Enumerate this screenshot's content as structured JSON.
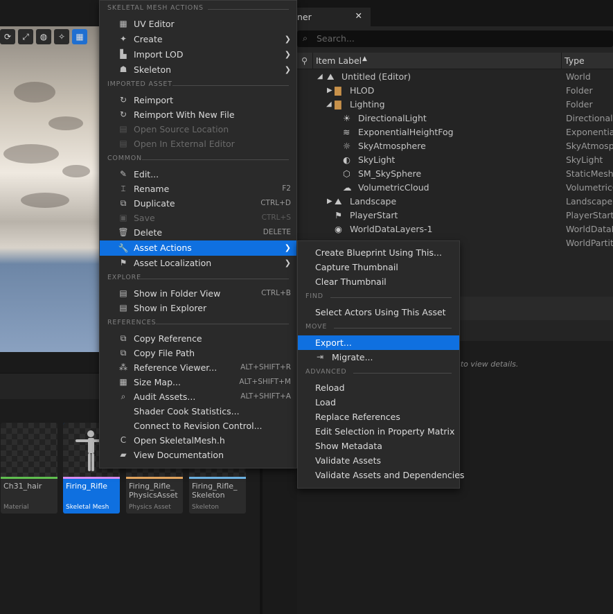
{
  "context_menu": {
    "sections": {
      "skeletal_mesh_actions": "SKELETAL MESH ACTIONS",
      "imported_asset": "IMPORTED ASSET",
      "common": "COMMON",
      "explore": "EXPLORE",
      "references": "REFERENCES"
    },
    "items": {
      "uv_editor": "UV Editor",
      "create": "Create",
      "import_lod": "Import LOD",
      "skeleton": "Skeleton",
      "reimport": "Reimport",
      "reimport_new": "Reimport With New File",
      "open_source": "Open Source Location",
      "open_external": "Open In External Editor",
      "edit": "Edit...",
      "rename": "Rename",
      "duplicate": "Duplicate",
      "save": "Save",
      "delete": "Delete",
      "asset_actions": "Asset Actions",
      "asset_localization": "Asset Localization",
      "show_folder": "Show in Folder View",
      "show_explorer": "Show in Explorer",
      "copy_reference": "Copy Reference",
      "copy_file_path": "Copy File Path",
      "reference_viewer": "Reference Viewer...",
      "size_map": "Size Map...",
      "audit_assets": "Audit Assets...",
      "shader_cook": "Shader Cook Statistics...",
      "connect_revision": "Connect to Revision Control...",
      "open_source_file": "Open SkeletalMesh.h",
      "view_docs": "View Documentation"
    },
    "shortcuts": {
      "rename": "F2",
      "duplicate": "CTRL+D",
      "save": "CTRL+S",
      "delete": "DELETE",
      "show_folder": "CTRL+B",
      "reference_viewer": "ALT+SHIFT+R",
      "size_map": "ALT+SHIFT+M",
      "audit_assets": "ALT+SHIFT+A"
    }
  },
  "submenu": {
    "sections": {
      "find": "FIND",
      "move": "MOVE",
      "advanced": "ADVANCED"
    },
    "items": {
      "create_blueprint": "Create Blueprint Using This...",
      "capture_thumbnail": "Capture Thumbnail",
      "clear_thumbnail": "Clear Thumbnail",
      "select_actors": "Select Actors Using This Asset",
      "export": "Export...",
      "migrate": "Migrate...",
      "reload": "Reload",
      "load": "Load",
      "replace_refs": "Replace References",
      "edit_matrix": "Edit Selection in Property Matrix",
      "show_metadata": "Show Metadata",
      "validate_assets": "Validate Assets",
      "validate_deps": "Validate Assets and Dependencies"
    }
  },
  "outliner": {
    "tab_label": "ner",
    "search_placeholder": "Search...",
    "col_label": "Item Label",
    "col_type": "Type",
    "rows": [
      {
        "label": "Untitled (Editor)",
        "type": "World"
      },
      {
        "label": "HLOD",
        "type": "Folder"
      },
      {
        "label": "Lighting",
        "type": "Folder"
      },
      {
        "label": "DirectionalLight",
        "type": "DirectionalL"
      },
      {
        "label": "ExponentialHeightFog",
        "type": "ExponentialH"
      },
      {
        "label": "SkyAtmosphere",
        "type": "SkyAtmosph"
      },
      {
        "label": "SkyLight",
        "type": "SkyLight"
      },
      {
        "label": "SM_SkySphere",
        "type": "StaticMesh/"
      },
      {
        "label": "VolumetricCloud",
        "type": "VolumetricC"
      },
      {
        "label": "Landscape",
        "type": "Landscape"
      },
      {
        "label": "PlayerStart",
        "type": "PlayerStart"
      },
      {
        "label": "WorldDataLayers-1",
        "type": "WorldDataL"
      },
      {
        "label": "",
        "type": "WorldPartiti"
      }
    ]
  },
  "details": {
    "hint": "ct to view details."
  },
  "assets": [
    {
      "name": "Ch31_hair",
      "kind": "Material",
      "color": "#5fbf4f"
    },
    {
      "name": "Firing_Rifle",
      "kind": "Skeletal Mesh",
      "color": "#d98cf2"
    },
    {
      "name": "Firing_Rifle_ PhysicsAsset",
      "kind": "Physics Asset",
      "color": "#e6a860"
    },
    {
      "name": "Firing_Rifle_ Skeleton",
      "kind": "Skeleton",
      "color": "#6fb5e6"
    }
  ],
  "colors": {
    "accent": "#0f70e0",
    "menu_bg": "#2a2a2a",
    "panel_bg": "#242424"
  }
}
